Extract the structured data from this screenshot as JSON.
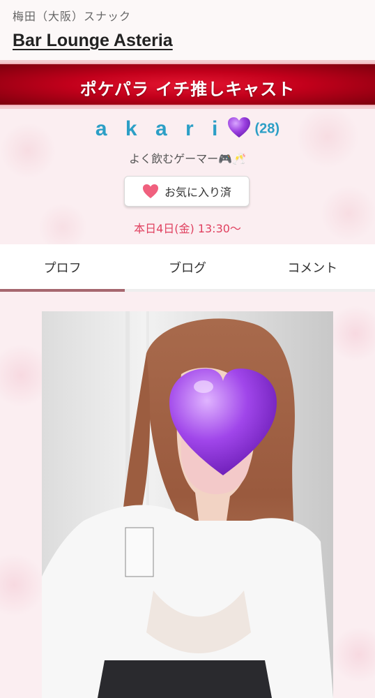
{
  "header": {
    "area_genre": "梅田（大阪）スナック",
    "shop_name": "Bar Lounge Asteria"
  },
  "banner": {
    "title": "ポケパラ イチ推しキャスト"
  },
  "cast": {
    "name": "a k a r i",
    "age": "(28)",
    "catchcopy": "よく飲むゲーマー🎮🥂",
    "favorite_label": "お気に入り済",
    "schedule": "本日4日(金) 13:30〜",
    "name_heart_icon": "purple-heart-icon",
    "favorite_icon": "heart-icon"
  },
  "tabs": [
    {
      "label": "プロフ",
      "active": true
    },
    {
      "label": "ブログ",
      "active": false
    },
    {
      "label": "コメント",
      "active": false
    }
  ],
  "photo": {
    "overlay_icon": "purple-heart-icon"
  },
  "colors": {
    "banner_red": "#c4001c",
    "name_blue": "#2c9fc6",
    "schedule_pink": "#e0405f",
    "tab_indicator": "#a6676f",
    "heart_purple": "#9b3fe0"
  }
}
